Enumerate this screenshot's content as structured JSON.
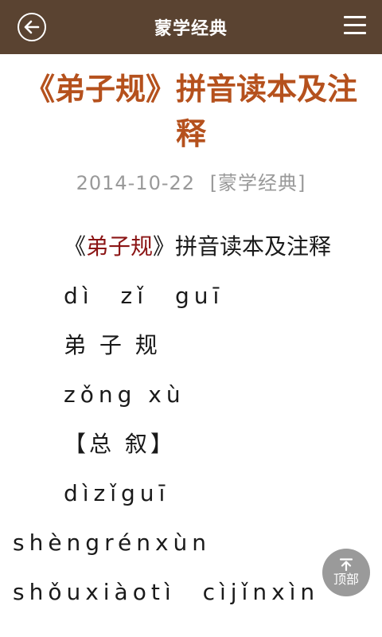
{
  "header": {
    "title": "蒙学经典",
    "back_icon": "arrow-left-circle",
    "menu_icon": "hamburger-menu"
  },
  "article": {
    "title": "《弟子规》拼音读本及注释",
    "date": "2014-10-22",
    "category": "[蒙学经典]",
    "intro_open": "《",
    "intro_book": "弟子规",
    "intro_rest": "》拼音读本及注释",
    "lines": [
      "dì　zǐ　guī",
      "弟 子 规",
      "zǒng xù",
      "【总 叙】",
      "dìzǐguī",
      "shèngrénxùn",
      "shǒuxiàotì　cìjǐnxìn"
    ]
  },
  "back_to_top": {
    "label": "顶部",
    "icon": "arrow-up-to-top"
  },
  "colors": {
    "topbar": "#5a4331",
    "title": "#b5511d",
    "book_name": "#8b1515",
    "meta": "#999999"
  }
}
